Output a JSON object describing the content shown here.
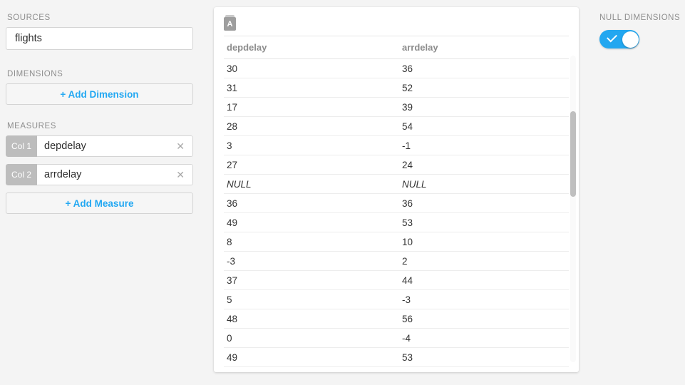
{
  "sidebar": {
    "sources": {
      "label": "SOURCES",
      "value": "flights",
      "placeholder": "Source"
    },
    "dimensions": {
      "label": "DIMENSIONS",
      "add_label": "+ Add Dimension"
    },
    "measures": {
      "label": "MEASURES",
      "add_label": "+ Add Measure",
      "items": [
        {
          "badge": "Col 1",
          "value": "depdelay",
          "remove_icon": "close-icon"
        },
        {
          "badge": "Col 2",
          "value": "arrdelay",
          "remove_icon": "close-icon"
        }
      ]
    }
  },
  "panel": {
    "type_icon": "text-type-icon",
    "type_icon_glyph": "A",
    "columns": [
      "depdelay",
      "arrdelay"
    ],
    "rows": [
      [
        "30",
        "36"
      ],
      [
        "31",
        "52"
      ],
      [
        "17",
        "39"
      ],
      [
        "28",
        "54"
      ],
      [
        "3",
        "-1"
      ],
      [
        "27",
        "24"
      ],
      [
        "NULL",
        "NULL"
      ],
      [
        "36",
        "36"
      ],
      [
        "49",
        "53"
      ],
      [
        "8",
        "10"
      ],
      [
        "-3",
        "2"
      ],
      [
        "37",
        "44"
      ],
      [
        "5",
        "-3"
      ],
      [
        "48",
        "56"
      ],
      [
        "0",
        "-4"
      ],
      [
        "49",
        "53"
      ]
    ]
  },
  "right_panel": {
    "label": "NULL DIMENSIONS",
    "toggle_on": true
  },
  "colors": {
    "accent_blue": "#23a8f2",
    "toggle_on": "#22a7f0",
    "badge_grey": "#bdbdbd",
    "page_bg": "#f4f4f4",
    "panel_bg": "#ffffff",
    "label_grey": "#8e8e8e"
  }
}
